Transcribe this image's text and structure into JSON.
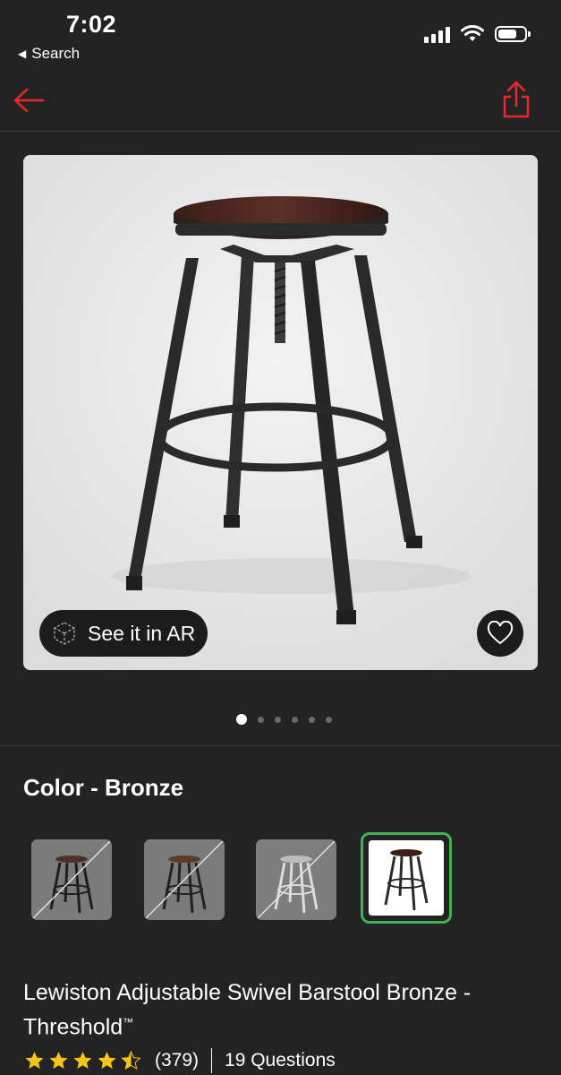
{
  "status": {
    "time": "7:02",
    "back_label": "Search"
  },
  "nav": {
    "back_icon": "arrow-left-icon",
    "share_icon": "share-icon",
    "accent": "#e8282d"
  },
  "media": {
    "ar_label": "See it in AR",
    "page_count": 6,
    "active_page": 1
  },
  "color": {
    "label": "Color - Bronze",
    "selected_index": 3,
    "options_count": 4
  },
  "product": {
    "title": "Lewiston Adjustable Swivel Barstool Bronze - Threshold",
    "trademark": "™",
    "rating": 4.5,
    "review_count": "(379)",
    "questions": "19 Questions"
  },
  "colors": {
    "star": "#f5c518",
    "selected_border": "#3fb34f"
  }
}
